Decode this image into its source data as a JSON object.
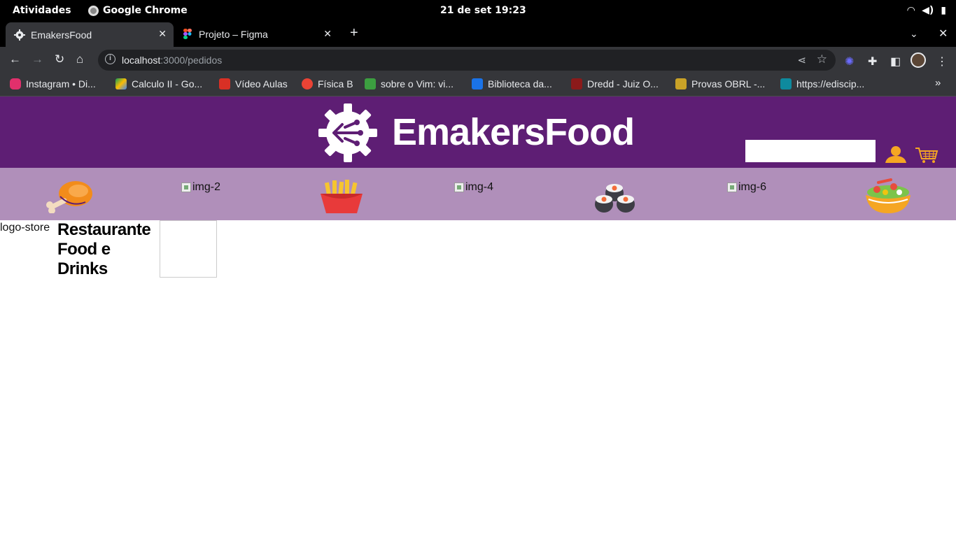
{
  "system": {
    "activities": "Atividades",
    "app_name": "Google Chrome",
    "clock": "21 de set  19:23"
  },
  "browser": {
    "tabs": [
      {
        "title": "EmakersFood",
        "active": true
      },
      {
        "title": "Projeto – Figma",
        "active": false
      }
    ],
    "address": {
      "host": "localhost",
      "path": ":3000/pedidos"
    },
    "bookmarks": [
      {
        "label": "Instagram • Di...",
        "color": "#e1306c"
      },
      {
        "label": "Calculo II - Go...",
        "color": "#fbbc04"
      },
      {
        "label": "Vídeo Aulas",
        "color": "#d93025"
      },
      {
        "label": "Física B",
        "color": "#ea4335"
      },
      {
        "label": "sobre o Vim: vi...",
        "color": "#3c9f40"
      },
      {
        "label": "Biblioteca da...",
        "color": "#1a73e8"
      },
      {
        "label": "Dredd - Juiz O...",
        "color": "#8b1a1a"
      },
      {
        "label": "Provas OBRL -...",
        "color": "#c9a227"
      },
      {
        "label": "https://ediscip...",
        "color": "#0e8a9e"
      }
    ]
  },
  "site": {
    "brand": "EmakersFood",
    "search": {
      "value": "",
      "placeholder": ""
    },
    "colors": {
      "header": "#5e1e74",
      "catbar": "#b08fba",
      "accent": "#f5a623"
    },
    "categories": [
      {
        "kind": "icon",
        "name": "chicken-leg-icon"
      },
      {
        "kind": "broken",
        "alt": "img-2"
      },
      {
        "kind": "icon",
        "name": "french-fries-icon"
      },
      {
        "kind": "broken",
        "alt": "img-4"
      },
      {
        "kind": "icon",
        "name": "sushi-icon"
      },
      {
        "kind": "broken",
        "alt": "img-6"
      },
      {
        "kind": "icon",
        "name": "salad-bowl-icon"
      }
    ],
    "store": {
      "logo_alt": "logo-store",
      "name": "Restaurante Food e Drinks"
    }
  }
}
